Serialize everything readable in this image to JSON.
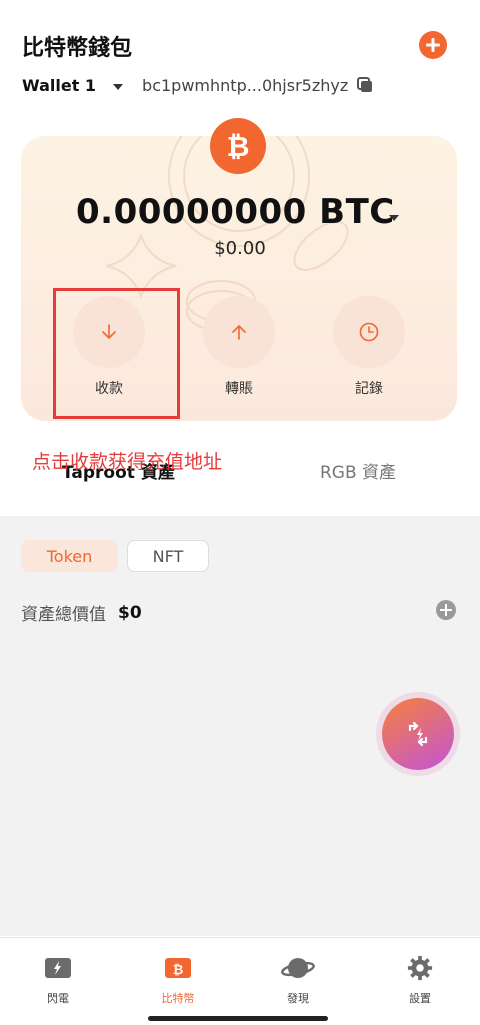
{
  "header": {
    "title": "比特幣錢包"
  },
  "wallet": {
    "name": "Wallet 1",
    "address": "bc1pwmhntp...0hjsr5zhyz"
  },
  "card": {
    "balance": "0.00000000 BTC",
    "balance_usd": "$0.00",
    "actions": [
      {
        "label": "收款",
        "icon": "arrow-down-icon"
      },
      {
        "label": "轉賬",
        "icon": "arrow-up-icon"
      },
      {
        "label": "記錄",
        "icon": "clock-icon"
      }
    ]
  },
  "annotation": {
    "tip": "点击收款获得充值地址"
  },
  "asset_tabs": {
    "taproot": "Taproot 資產",
    "rgb": "RGB 資產"
  },
  "chips": {
    "token": "Token",
    "nft": "NFT"
  },
  "assets": {
    "total_label": "資產總價值",
    "total_value": "$0"
  },
  "bottom_nav": [
    {
      "label": "閃電",
      "icon": "lightning-wallet-icon"
    },
    {
      "label": "比特幣",
      "icon": "bitcoin-wallet-icon"
    },
    {
      "label": "發現",
      "icon": "planet-icon"
    },
    {
      "label": "設置",
      "icon": "gear-icon"
    }
  ],
  "colors": {
    "accent": "#f2662f",
    "annotation": "#e63b3b"
  }
}
